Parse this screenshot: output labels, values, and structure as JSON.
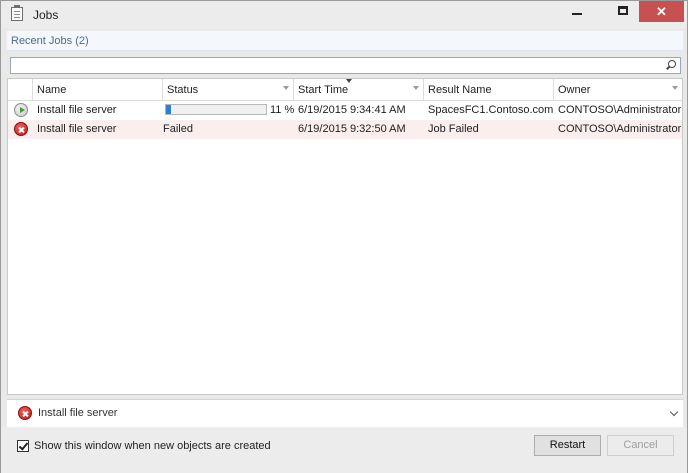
{
  "window": {
    "title": "Jobs",
    "minimize_glyph": "",
    "maximize_glyph": "",
    "close_glyph": "✕"
  },
  "panel": {
    "title": "Recent Jobs (2)"
  },
  "search": {
    "value": "",
    "placeholder": ""
  },
  "table": {
    "columns": [
      "Name",
      "Status",
      "Start Time",
      "Result Name",
      "Owner"
    ],
    "sorted_column": "Start Time",
    "rows": [
      {
        "icon": "running-play-icon",
        "name": "Install file server",
        "status": "",
        "progress": 11,
        "progress_label": "11 %",
        "start_time": "6/19/2015 9:34:41 AM",
        "result_name": "SpacesFC1.Contoso.com",
        "owner": "CONTOSO\\Administrator"
      },
      {
        "icon": "error-icon",
        "name": "Install file server",
        "status": "Failed",
        "progress": null,
        "progress_label": "",
        "start_time": "6/19/2015 9:32:50 AM",
        "result_name": "Job Failed",
        "owner": "CONTOSO\\Administrator"
      }
    ]
  },
  "details": {
    "title": "Install file server",
    "icon": "error-icon"
  },
  "footer": {
    "checkbox_label": "Show this window when new objects are created",
    "checkbox_checked": true,
    "restart_label": "Restart",
    "cancel_label": "Cancel"
  },
  "colors": {
    "progress_fill": "#2d7fd1",
    "failed_row": "#fbeeee",
    "close_button": "#c75050",
    "panel_title": "#4f6b8c"
  }
}
